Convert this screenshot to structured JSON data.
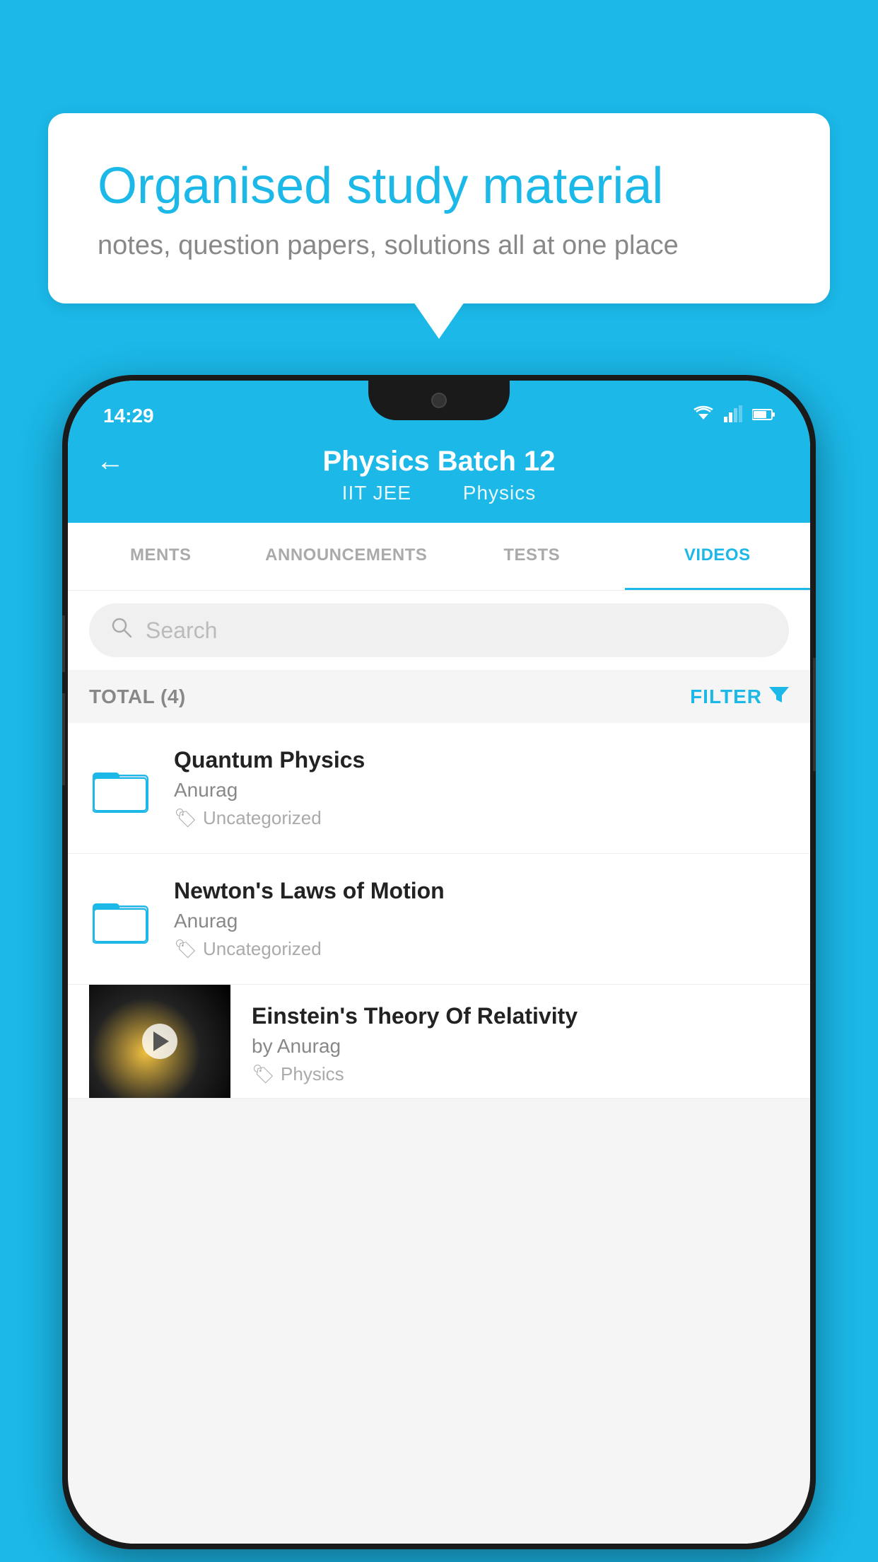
{
  "background_color": "#1BB8E8",
  "bubble": {
    "title": "Organised study material",
    "subtitle": "notes, question papers, solutions all at one place"
  },
  "phone": {
    "status_bar": {
      "time": "14:29",
      "icons": [
        "wifi",
        "signal",
        "battery"
      ]
    },
    "header": {
      "back_label": "←",
      "title": "Physics Batch 12",
      "subtitle_parts": [
        "IIT JEE",
        "Physics"
      ]
    },
    "tabs": [
      {
        "label": "MENTS",
        "active": false
      },
      {
        "label": "ANNOUNCEMENTS",
        "active": false
      },
      {
        "label": "TESTS",
        "active": false
      },
      {
        "label": "VIDEOS",
        "active": true
      }
    ],
    "search": {
      "placeholder": "Search"
    },
    "filter_row": {
      "total_label": "TOTAL (4)",
      "filter_label": "FILTER"
    },
    "videos": [
      {
        "id": "quantum",
        "title": "Quantum Physics",
        "author": "Anurag",
        "tag": "Uncategorized",
        "type": "folder",
        "has_thumb": false
      },
      {
        "id": "newton",
        "title": "Newton's Laws of Motion",
        "author": "Anurag",
        "tag": "Uncategorized",
        "type": "folder",
        "has_thumb": false
      },
      {
        "id": "einstein",
        "title": "Einstein's Theory Of Relativity",
        "author": "by Anurag",
        "tag": "Physics",
        "type": "video",
        "has_thumb": true
      }
    ]
  }
}
